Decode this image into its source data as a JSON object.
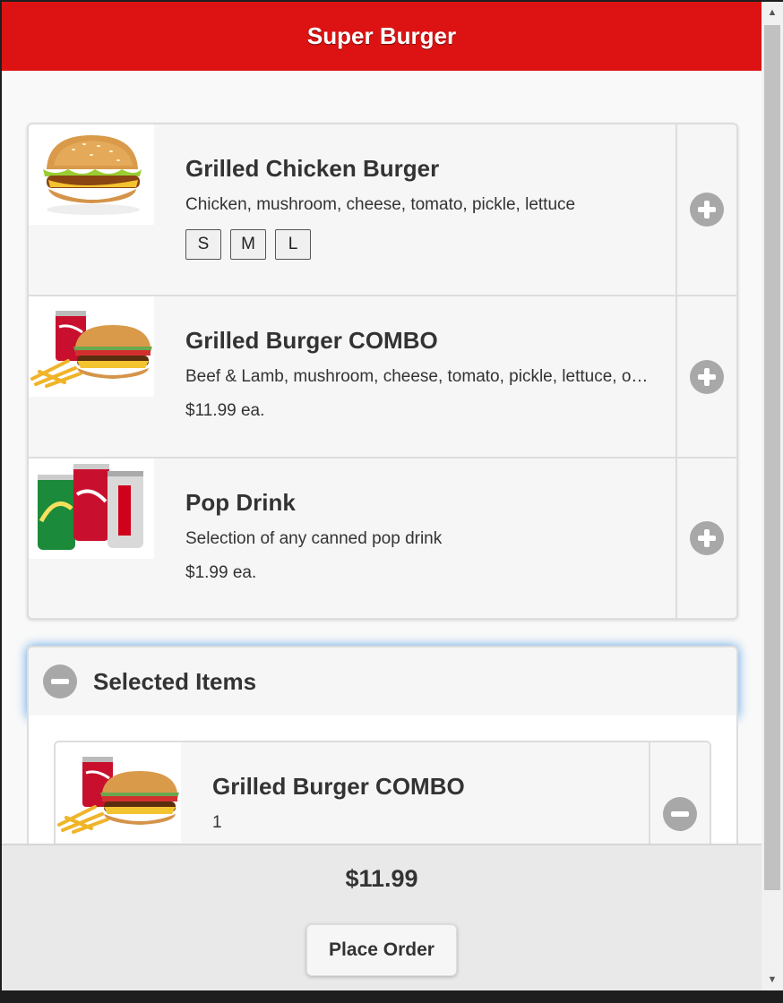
{
  "app": {
    "title": "Super Burger"
  },
  "colors": {
    "header_bg": "#dd1313",
    "header_text": "#ffffff",
    "icon_gray": "#a8a8a8",
    "focus_glow": "#5aa0e6"
  },
  "menu": {
    "items": [
      {
        "title": "Grilled Chicken Burger",
        "description": "Chicken, mushroom, cheese, tomato, pickle, lettuce",
        "sizes": [
          "S",
          "M",
          "L"
        ],
        "image": "chicken-burger-image",
        "action_icon": "plus-circle-icon"
      },
      {
        "title": "Grilled Burger COMBO",
        "description": "Beef & Lamb, mushroom, cheese, tomato, pickle, lettuce, onion",
        "price": "$11.99 ea.",
        "image": "burger-combo-image",
        "action_icon": "plus-circle-icon"
      },
      {
        "title": "Pop Drink",
        "description": "Selection of any canned pop drink",
        "price": "$1.99 ea.",
        "image": "pop-cans-image",
        "action_icon": "plus-circle-icon"
      }
    ]
  },
  "selected": {
    "title": "Selected Items",
    "toggle_icon": "minus-circle-icon",
    "items": [
      {
        "title": "Grilled Burger COMBO",
        "quantity": "1",
        "image": "burger-combo-image",
        "action_icon": "minus-circle-icon"
      }
    ]
  },
  "footer": {
    "total": "$11.99",
    "place_order_label": "Place Order"
  },
  "scrollbar": {
    "up_icon": "▲",
    "down_icon": "▼"
  }
}
